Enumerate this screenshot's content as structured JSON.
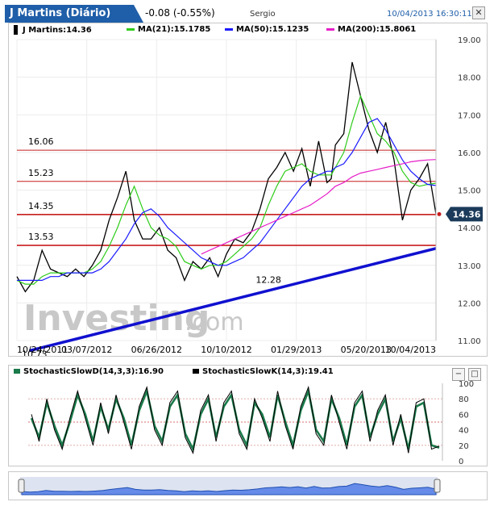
{
  "header": {
    "title": "J Martins (Diário)",
    "change": "-0.08 (-0.55%)",
    "sub": "Sergio",
    "datetime": "10/04/2013 16:30:11",
    "close_glyph": "✕"
  },
  "main_legend": {
    "symbol": "J Martins:14.36",
    "ma21": "MA(21):15.1785",
    "ma50": "MA(50):15.1235",
    "ma200": "MA(200):15.8061"
  },
  "watermark": {
    "brand": "Investing",
    "suffix": ".com"
  },
  "stoch_legend": {
    "slowd": "StochasticSlowD(14,3,3):16.90",
    "slowk": "StochasticSlowK(14,3):19.41",
    "minimize_glyph": "−",
    "maximize_glyph": "□"
  },
  "chart_data": [
    {
      "type": "line",
      "ylim": [
        11.0,
        19.0
      ],
      "y_ticks": [
        "19.00",
        "18.00",
        "17.00",
        "16.00",
        "15.00",
        "14.00",
        "13.00",
        "12.00",
        "11.00"
      ],
      "x_ticks": [
        "10/24/2011",
        "03/07/2012",
        "06/26/2012",
        "10/10/2012",
        "01/29/2013",
        "05/20/2013",
        "10/04/2013"
      ],
      "horizontal_lines": [
        {
          "label": "16.06",
          "value": 16.06
        },
        {
          "label": "15.23",
          "value": 15.23
        },
        {
          "label": "14.35",
          "value": 14.35
        },
        {
          "label": "13.53",
          "value": 13.53
        }
      ],
      "last_price": {
        "label": "14.36",
        "value": 14.36
      },
      "annotations": [
        {
          "label": "12.28"
        },
        {
          "label": "10.73"
        }
      ],
      "trendline": {
        "from": [
          0.03,
          10.73
        ],
        "to": [
          1.0,
          13.45
        ]
      },
      "x": [
        0,
        0.02,
        0.04,
        0.06,
        0.08,
        0.1,
        0.12,
        0.14,
        0.16,
        0.18,
        0.2,
        0.22,
        0.24,
        0.26,
        0.28,
        0.3,
        0.32,
        0.34,
        0.36,
        0.38,
        0.4,
        0.42,
        0.44,
        0.46,
        0.48,
        0.5,
        0.52,
        0.54,
        0.56,
        0.58,
        0.6,
        0.62,
        0.64,
        0.66,
        0.68,
        0.7,
        0.72,
        0.74,
        0.75,
        0.76,
        0.78,
        0.8,
        0.82,
        0.84,
        0.86,
        0.88,
        0.9,
        0.92,
        0.94,
        0.96,
        0.98,
        1.0
      ],
      "series": [
        {
          "name": "J Martins",
          "color": "#000000",
          "values": [
            12.7,
            12.3,
            12.6,
            13.4,
            12.9,
            12.8,
            12.7,
            12.9,
            12.7,
            13.0,
            13.4,
            14.2,
            14.8,
            15.5,
            14.2,
            13.7,
            13.7,
            14.0,
            13.4,
            13.2,
            12.6,
            13.1,
            12.9,
            13.2,
            12.7,
            13.3,
            13.7,
            13.6,
            13.9,
            14.5,
            15.3,
            15.6,
            16.0,
            15.5,
            16.1,
            15.1,
            16.3,
            15.2,
            15.3,
            16.2,
            16.5,
            18.4,
            17.5,
            16.6,
            16.0,
            16.8,
            15.8,
            14.2,
            15.0,
            15.3,
            15.7,
            14.36
          ]
        },
        {
          "name": "MA(21)",
          "color": "#2ecc1a",
          "values": [
            12.6,
            12.5,
            12.5,
            12.7,
            12.8,
            12.8,
            12.8,
            12.8,
            12.8,
            12.9,
            13.1,
            13.5,
            14.0,
            14.6,
            15.1,
            14.5,
            14.0,
            13.8,
            13.7,
            13.5,
            13.1,
            13.0,
            12.9,
            13.0,
            13.0,
            13.1,
            13.3,
            13.5,
            13.7,
            14.0,
            14.6,
            15.1,
            15.5,
            15.6,
            15.7,
            15.5,
            15.4,
            15.4,
            15.4,
            15.6,
            16.0,
            16.8,
            17.5,
            17.0,
            16.5,
            16.3,
            16.0,
            15.5,
            15.2,
            15.1,
            15.15,
            15.18
          ]
        },
        {
          "name": "MA(50)",
          "color": "#1a1aff",
          "values": [
            12.6,
            12.6,
            12.6,
            12.6,
            12.7,
            12.7,
            12.8,
            12.8,
            12.8,
            12.8,
            12.9,
            13.1,
            13.4,
            13.7,
            14.1,
            14.4,
            14.5,
            14.3,
            14.0,
            13.8,
            13.6,
            13.4,
            13.2,
            13.1,
            13.0,
            13.0,
            13.1,
            13.2,
            13.4,
            13.6,
            13.9,
            14.2,
            14.5,
            14.8,
            15.1,
            15.3,
            15.4,
            15.5,
            15.5,
            15.6,
            15.7,
            16.0,
            16.4,
            16.8,
            16.9,
            16.6,
            16.2,
            15.8,
            15.5,
            15.3,
            15.15,
            15.12
          ]
        },
        {
          "name": "MA(200)",
          "color": "#e61ec8",
          "values": [
            null,
            null,
            null,
            null,
            null,
            null,
            null,
            null,
            null,
            null,
            null,
            null,
            null,
            null,
            null,
            null,
            null,
            null,
            null,
            null,
            null,
            null,
            13.3,
            13.4,
            13.5,
            13.6,
            13.7,
            13.8,
            13.9,
            14.0,
            14.1,
            14.2,
            14.3,
            14.4,
            14.5,
            14.6,
            14.75,
            14.9,
            15.0,
            15.1,
            15.2,
            15.35,
            15.45,
            15.5,
            15.55,
            15.6,
            15.65,
            15.7,
            15.75,
            15.78,
            15.8,
            15.81
          ]
        }
      ]
    },
    {
      "type": "line",
      "ylim": [
        0,
        100
      ],
      "y_ticks": [
        "100",
        "80",
        "60",
        "40",
        "20",
        "0"
      ],
      "series": [
        {
          "name": "StochasticSlowD(14,3,3)",
          "color": "#1a7a4a",
          "values": [
            55,
            30,
            75,
            45,
            20,
            50,
            85,
            60,
            25,
            70,
            40,
            80,
            55,
            20,
            65,
            90,
            45,
            25,
            70,
            85,
            35,
            15,
            60,
            80,
            30,
            70,
            85,
            40,
            20,
            75,
            60,
            30,
            85,
            50,
            20,
            65,
            90,
            40,
            25,
            80,
            55,
            20,
            70,
            85,
            30,
            60,
            80,
            25,
            55,
            15,
            70,
            75,
            20,
            17
          ]
        },
        {
          "name": "StochasticSlowK(14,3)",
          "color": "#000000",
          "values": [
            60,
            25,
            80,
            40,
            15,
            55,
            90,
            55,
            20,
            75,
            35,
            85,
            50,
            15,
            70,
            95,
            40,
            20,
            75,
            90,
            30,
            10,
            65,
            85,
            25,
            75,
            90,
            35,
            15,
            80,
            55,
            25,
            90,
            45,
            15,
            70,
            95,
            35,
            20,
            85,
            50,
            15,
            75,
            90,
            25,
            65,
            85,
            20,
            60,
            10,
            75,
            80,
            15,
            19
          ]
        }
      ]
    }
  ]
}
